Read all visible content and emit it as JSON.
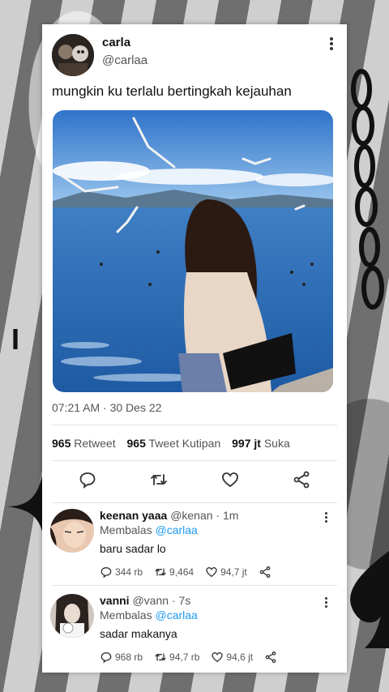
{
  "tweet": {
    "author_name": "carla",
    "author_handle": "@carlaa",
    "text": "mungkin ku terlalu bertingkah kejauhan",
    "timestamp": "07:21 AM · 30 Des 22",
    "stats": {
      "retweets_count": "965",
      "retweets_label": "Retweet",
      "quotes_count": "965",
      "quotes_label": "Tweet Kutipan",
      "likes_count": "997 jt",
      "likes_label": "Suka"
    },
    "actions": [
      "reply-icon",
      "retweet-icon",
      "heart-icon",
      "share-icon"
    ]
  },
  "replies": [
    {
      "name": "keenan yaaa",
      "handle": "@kenan",
      "time": "· 1m",
      "replying_label": "Membalas",
      "replying_to": "@carlaa",
      "text": "baru sadar lo",
      "comments": "344 rb",
      "retweets": "9,464",
      "likes": "94,7 jt"
    },
    {
      "name": "vanni",
      "handle": "@vann",
      "time": "· 7s",
      "replying_label": "Membalas",
      "replying_to": "@carlaa",
      "text": "sadar makanya",
      "comments": "968 rb",
      "retweets": "94,7 rb",
      "likes": "94,6 jt"
    }
  ],
  "decor": {
    "letter": "I"
  },
  "colors": {
    "mention": "#1d9bf0",
    "sky": "#3f8fdc",
    "sea": "#2d6fb8"
  }
}
